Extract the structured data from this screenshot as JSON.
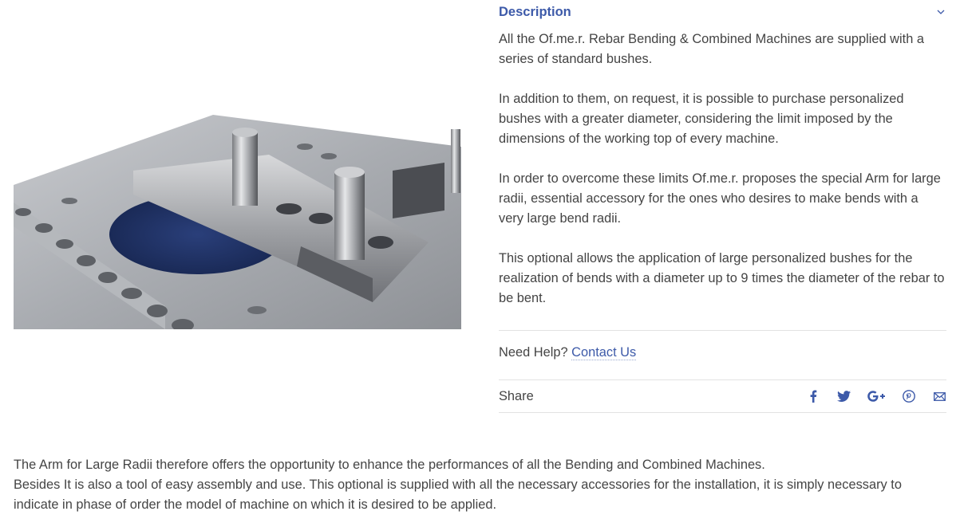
{
  "image": {
    "alt": ""
  },
  "description": {
    "title": "Description",
    "paragraphs": [
      "All the Of.me.r. Rebar Bending & Combined Machines are supplied with a series of standard bushes.",
      "In addition to them, on request, it is possible to purchase personalized bushes with a greater diameter, considering the limit imposed by the dimensions of the working top of every machine.",
      "In order to overcome these limits Of.me.r. proposes the special Arm for large radii, essential accessory for the ones who desires to make bends with a very large bend radii.",
      "This optional allows the application of large personalized bushes for the realization of bends with a diameter up to 9 times the diameter of the rebar to be bent."
    ]
  },
  "help": {
    "prefix": "Need Help?",
    "link": "Contact Us"
  },
  "share": {
    "label": "Share",
    "icons": [
      "facebook-icon",
      "twitter-icon",
      "google-plus-icon",
      "pinterest-icon",
      "email-icon"
    ]
  },
  "bottom": {
    "line1": "The Arm for Large Radii therefore offers the opportunity to enhance the performances of all the Bending and Combined Machines.",
    "line2": "Besides It is also a tool of easy assembly and use. This optional is supplied with all the necessary accessories for the installation, it is simply necessary to indicate in phase of order the model of machine on which it is desired to be applied."
  },
  "colors": {
    "accent": "#3d5aa9",
    "text": "#444444",
    "divider": "#e2e2e2"
  }
}
